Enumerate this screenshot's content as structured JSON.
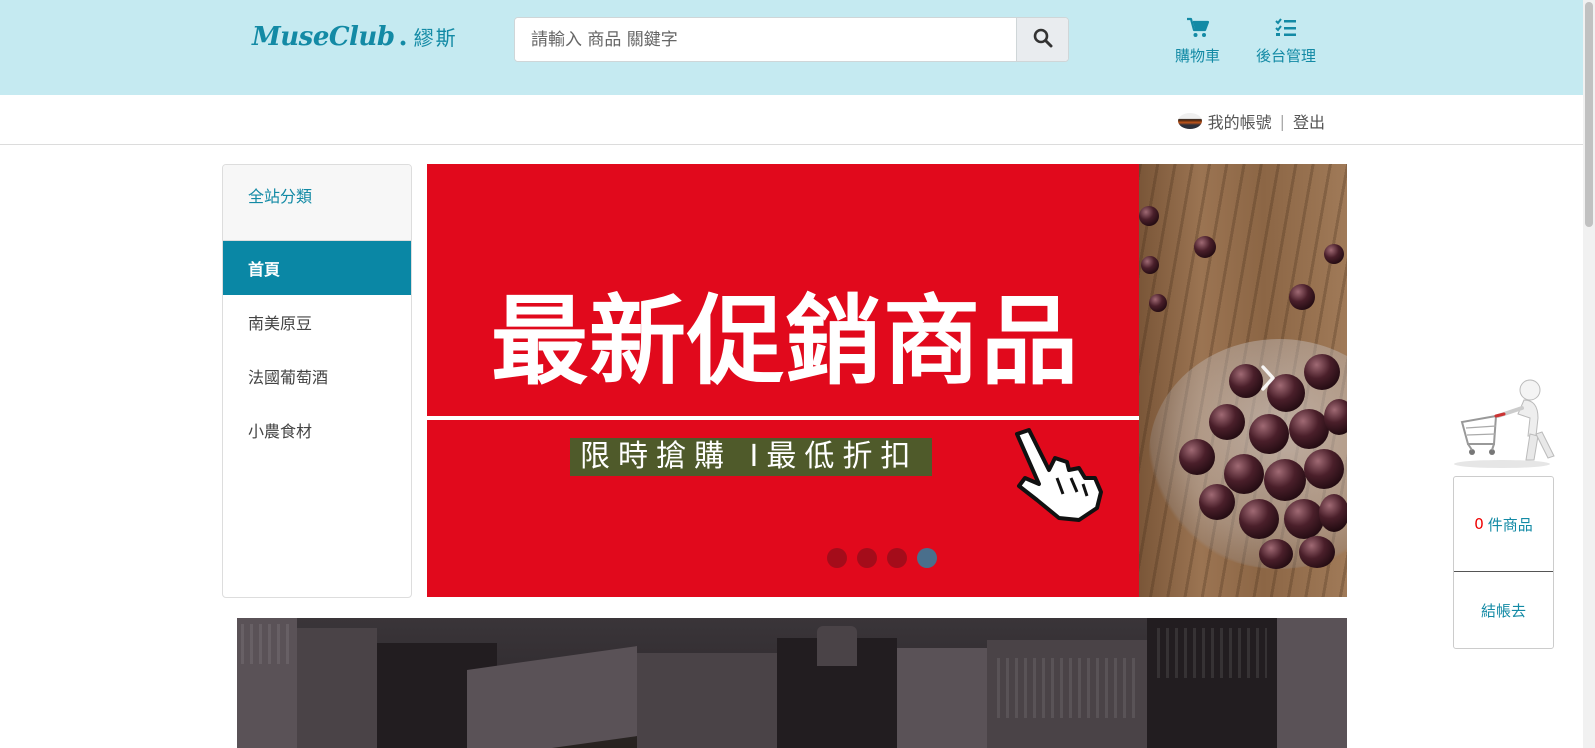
{
  "header": {
    "logo_main": "MuseClub",
    "logo_dot": ".",
    "logo_cn": "繆斯",
    "search_placeholder": "請輸入 商品 關鍵字",
    "search_icon": "magnifier-icon",
    "nav": {
      "cart_label": "購物車",
      "cart_icon": "cart-icon",
      "admin_label": "後台管理",
      "admin_icon": "checklist-icon"
    },
    "accent_color": "#138aa5",
    "background_color": "#c5eaf1"
  },
  "account": {
    "my_account": "我的帳號",
    "separator": "|",
    "logout": "登出"
  },
  "sidebar": {
    "heading": "全站分類",
    "items": [
      {
        "label": "首頁",
        "active": true
      },
      {
        "label": "南美原豆",
        "active": false
      },
      {
        "label": "法國葡萄酒",
        "active": false
      },
      {
        "label": "小農食材",
        "active": false
      }
    ],
    "active_color": "#0a87a5"
  },
  "carousel": {
    "title": "最新促銷商品",
    "subtitle": "限時搶購 I最低折扣",
    "slide_count": 4,
    "active_slide": 4,
    "next_icon": "chevron-right-icon",
    "banner_color": "#e1091c"
  },
  "cart_widget": {
    "count": "0",
    "count_suffix": "件商品",
    "checkout_label": "結帳去",
    "figure_icon": "person-pushing-cart-icon"
  }
}
